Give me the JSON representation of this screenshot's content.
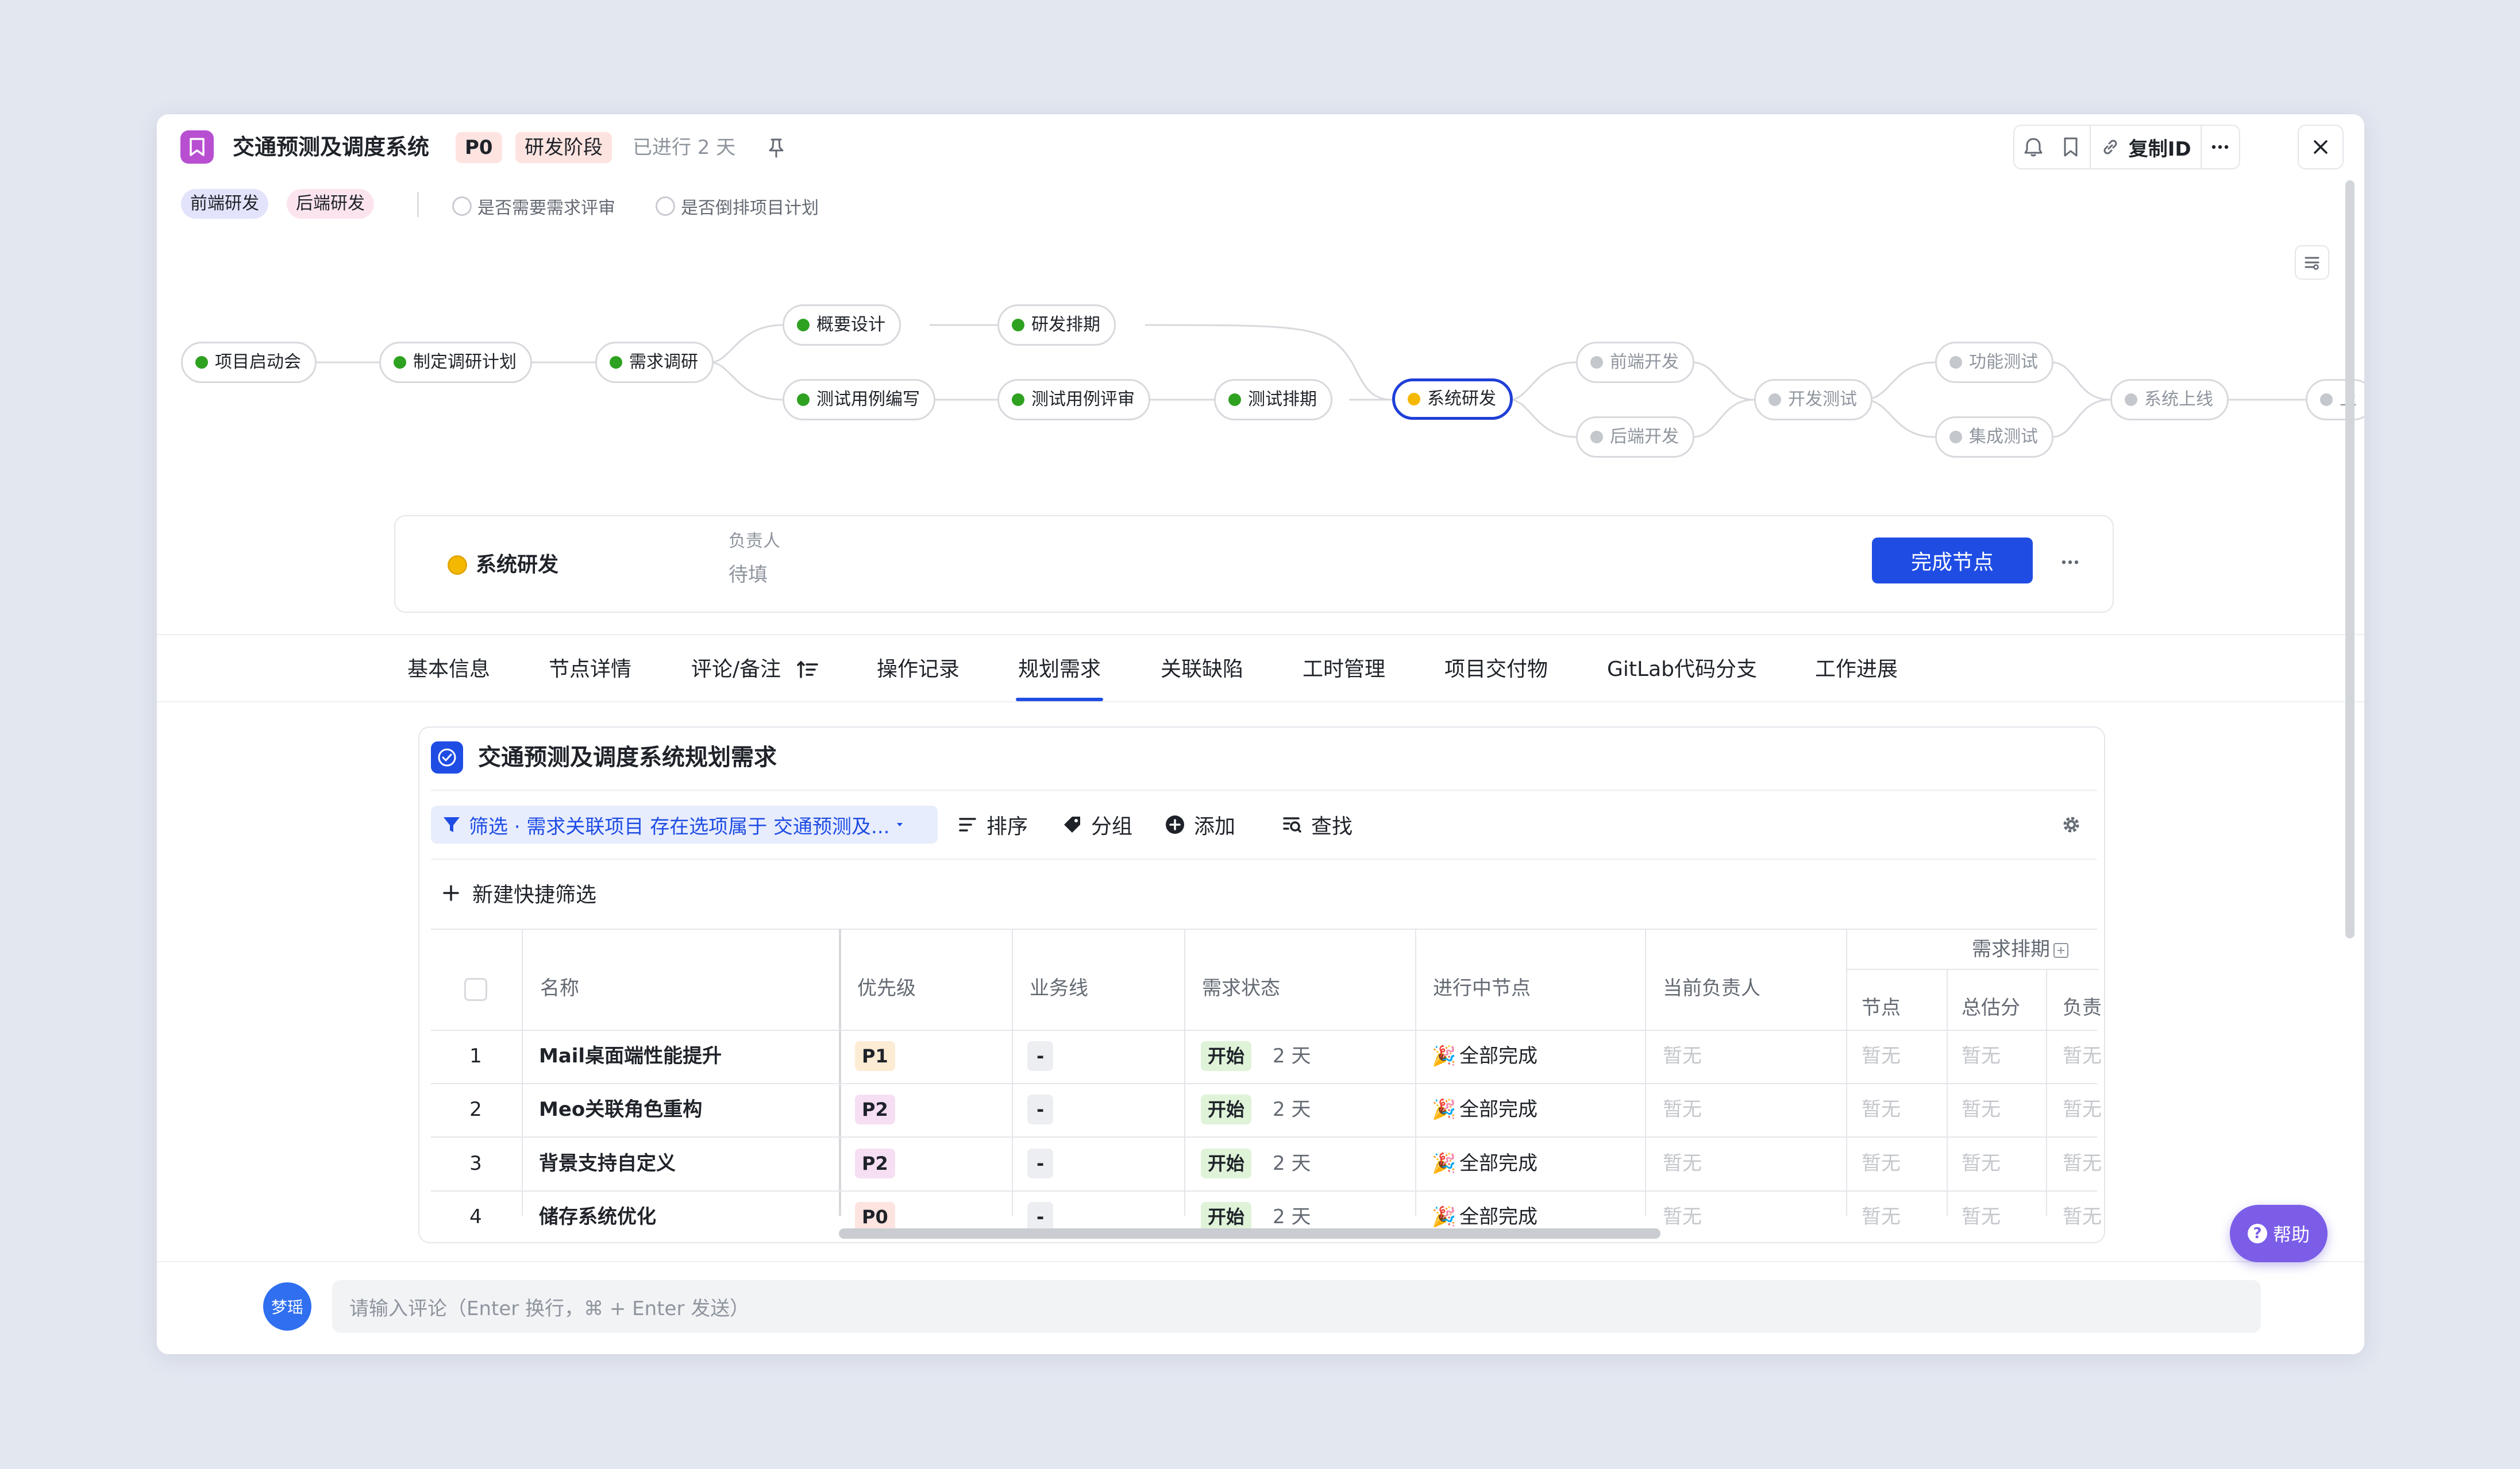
{
  "header": {
    "title": "交通预测及调度系统",
    "priority": "P0",
    "stage": "研发阶段",
    "elapsed": "已进行 2 天",
    "copy_id_label": "复制ID"
  },
  "tags": [
    "前端研发",
    "后端研发"
  ],
  "options": [
    "是否需要需求评审",
    "是否倒排项目计划"
  ],
  "flow": {
    "nodes": {
      "kickoff": "项目启动会",
      "research_plan": "制定调研计划",
      "req_research": "需求调研",
      "outline_design": "概要设计",
      "dev_schedule": "研发排期",
      "testcase_write": "测试用例编写",
      "testcase_review": "测试用例评审",
      "test_schedule": "测试排期",
      "sys_dev": "系统研发",
      "fe_dev": "前端开发",
      "be_dev": "后端开发",
      "dev_test": "开发测试",
      "func_test": "功能测试",
      "integ_test": "集成测试",
      "go_live": "系统上线",
      "next_truncated": "上"
    }
  },
  "current_node": {
    "name": "系统研发",
    "owner_label": "负责人",
    "owner_value": "待填",
    "complete_button": "完成节点"
  },
  "tabs": [
    "基本信息",
    "节点详情",
    "评论/备注",
    "操作记录",
    "规划需求",
    "关联缺陷",
    "工时管理",
    "项目交付物",
    "GitLab代码分支",
    "工作进展"
  ],
  "active_tab": "规划需求",
  "panel": {
    "title": "交通预测及调度系统规划需求",
    "filter": "筛选 · 需求关联项目 存在选项属于 交通预测及...",
    "tools": {
      "sort": "排序",
      "group": "分组",
      "add": "添加",
      "find": "查找"
    },
    "quick_filter": "新建快捷筛选"
  },
  "table": {
    "group_header": "需求排期",
    "columns": {
      "name": "名称",
      "priority": "优先级",
      "business_line": "业务线",
      "status": "需求状态",
      "in_progress_node": "进行中节点",
      "owner": "当前负责人",
      "node": "节点",
      "total_estimate": "总估分",
      "assignee": "负责"
    },
    "rows": [
      {
        "index": "1",
        "name": "Mail桌面端性能提升",
        "priority": "P1",
        "business_line": "-",
        "status": "开始",
        "days": "2 天",
        "node": "全部完成",
        "owner": "暂无",
        "sched_node": "暂无",
        "estimate": "暂无",
        "assignee": "暂无"
      },
      {
        "index": "2",
        "name": "Meo关联角色重构",
        "priority": "P2",
        "business_line": "-",
        "status": "开始",
        "days": "2 天",
        "node": "全部完成",
        "owner": "暂无",
        "sched_node": "暂无",
        "estimate": "暂无",
        "assignee": "暂无"
      },
      {
        "index": "3",
        "name": "背景支持自定义",
        "priority": "P2",
        "business_line": "-",
        "status": "开始",
        "days": "2 天",
        "node": "全部完成",
        "owner": "暂无",
        "sched_node": "暂无",
        "estimate": "暂无",
        "assignee": "暂无"
      },
      {
        "index": "4",
        "name": "储存系统优化",
        "priority": "P0",
        "business_line": "-",
        "status": "开始",
        "days": "2 天",
        "node": "全部完成",
        "owner": "暂无",
        "sched_node": "暂无",
        "estimate": "暂无",
        "assignee": "暂无"
      }
    ]
  },
  "comment": {
    "avatar": "梦瑶",
    "placeholder": "请输入评论（Enter 换行，⌘ + Enter 发送）"
  },
  "help": "帮助",
  "colors": {
    "primary": "#1f4de4",
    "done": "#2ea121",
    "current": "#f5b800",
    "app_icon": "#b84fd1",
    "help": "#7b5de8"
  }
}
